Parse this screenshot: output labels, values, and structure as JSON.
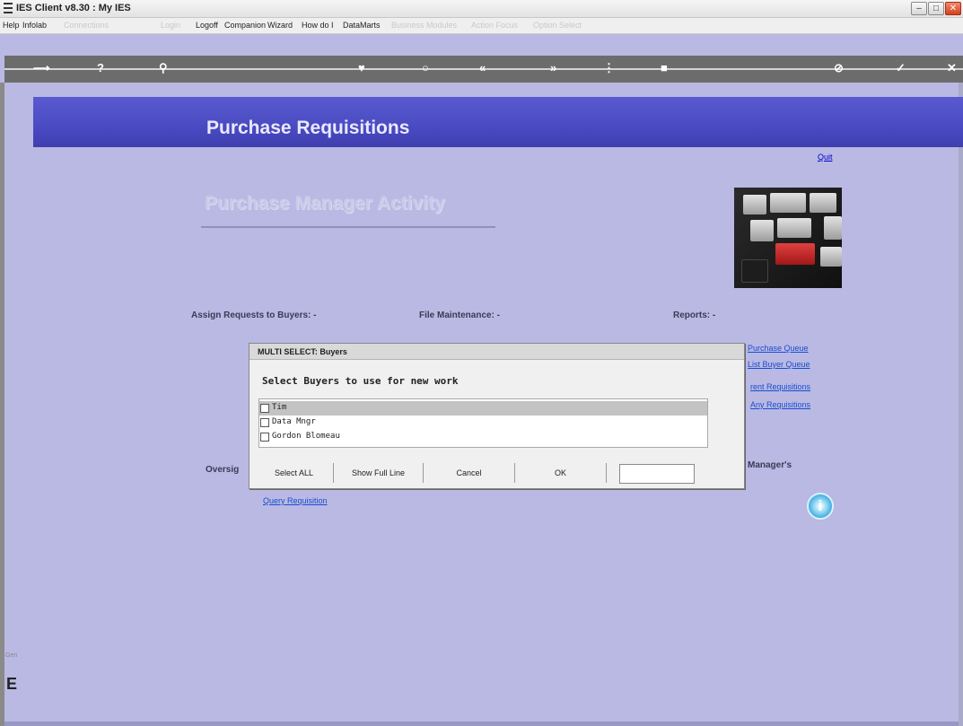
{
  "window": {
    "title": "IES Client v8.30 : My IES",
    "buttons": [
      "–",
      "□",
      "✕"
    ]
  },
  "menu": [
    {
      "label": "Help",
      "enabled": true
    },
    {
      "label": "Infolab",
      "enabled": true
    },
    {
      "label": "Connections",
      "enabled": false
    },
    {
      "label": "Login",
      "enabled": false
    },
    {
      "label": "Logoff",
      "enabled": true
    },
    {
      "label": "Companion",
      "enabled": true
    },
    {
      "label": "Wizard",
      "enabled": true
    },
    {
      "label": "How do I",
      "enabled": true
    },
    {
      "label": "DataMarts",
      "enabled": true
    },
    {
      "label": "Business Modules",
      "enabled": false
    },
    {
      "label": "Action Focus",
      "enabled": false
    },
    {
      "label": "Option Select",
      "enabled": false
    }
  ],
  "toolbar_icons": [
    {
      "name": "arrow-icon",
      "glyph": "⟶"
    },
    {
      "name": "help-icon",
      "glyph": "?"
    },
    {
      "name": "search-icon",
      "glyph": "⚲"
    },
    {
      "name": "favorite-icon",
      "glyph": "♥"
    },
    {
      "name": "refresh-icon",
      "glyph": "○"
    },
    {
      "name": "back-icon",
      "glyph": "«"
    },
    {
      "name": "forward-icon",
      "glyph": "»"
    },
    {
      "name": "menu-icon",
      "glyph": "⋮"
    },
    {
      "name": "stop-icon",
      "glyph": "■"
    },
    {
      "name": "cancel-icon",
      "glyph": "⊘"
    },
    {
      "name": "ok-icon",
      "glyph": "✓"
    },
    {
      "name": "close-icon",
      "glyph": "✕"
    }
  ],
  "page": {
    "banner_title": "Purchase Requisitions",
    "quit_label": "Quit",
    "heading": "Purchase Manager Activity",
    "sections": {
      "assign": "Assign Requests to Buyers: -",
      "file_maintenance": "File Maintenance: -",
      "reports": "Reports: -",
      "oversight": "Oversig",
      "managers": "Manager's"
    },
    "report_links": [
      "Purchase Queue",
      "List Buyer Queue",
      "rent Requisitions",
      "Any Requisitions"
    ],
    "query_link": "Query Requisition",
    "help_glyph": "i"
  },
  "sidebar": {
    "small_text": "Gen",
    "letter": "E"
  },
  "dialog": {
    "title": "MULTI SELECT: Buyers",
    "prompt": "Select Buyers to use for new work",
    "items": [
      {
        "label": "Tim",
        "checked": false,
        "selected": true
      },
      {
        "label": "Data Mngr",
        "checked": false,
        "selected": false
      },
      {
        "label": "Gordon Blomeau",
        "checked": false,
        "selected": false
      }
    ],
    "buttons": {
      "select_all": "Select ALL",
      "show_full_line": "Show Full Line",
      "cancel": "Cancel",
      "ok": "OK"
    },
    "input_value": ""
  },
  "colors": {
    "background": "#b9b9e3",
    "banner": "#4747bf",
    "link": "#1a4dd0"
  }
}
